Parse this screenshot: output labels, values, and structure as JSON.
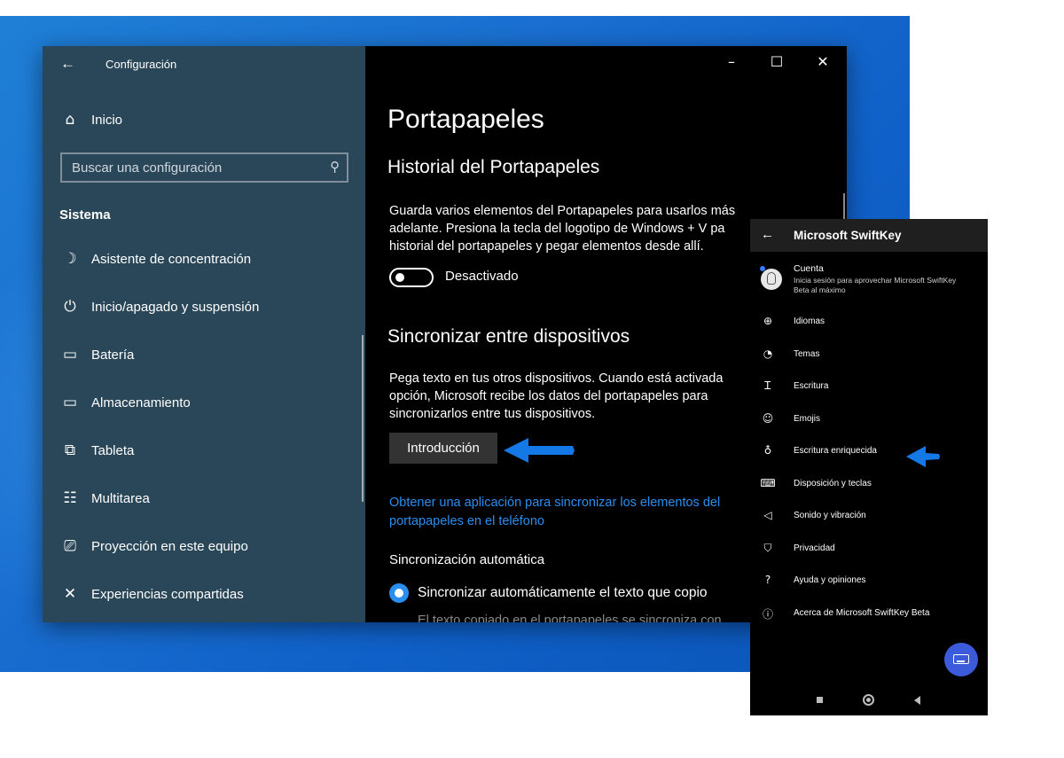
{
  "settings": {
    "window_title": "Configuración",
    "home_label": "Inicio",
    "search_placeholder": "Buscar una configuración",
    "section": "Sistema",
    "nav_items": [
      {
        "label": "Asistente de concentración",
        "icon": "moon-icon"
      },
      {
        "label": "Inicio/apagado y suspensión",
        "icon": "power-icon"
      },
      {
        "label": "Batería",
        "icon": "battery-icon"
      },
      {
        "label": "Almacenamiento",
        "icon": "storage-icon"
      },
      {
        "label": "Tableta",
        "icon": "tablet-icon"
      },
      {
        "label": "Multitarea",
        "icon": "multitask-icon"
      },
      {
        "label": "Proyección en este equipo",
        "icon": "projection-icon"
      },
      {
        "label": "Experiencias compartidas",
        "icon": "shared-experiences-icon"
      }
    ]
  },
  "content": {
    "page_title": "Portapapeles",
    "history_heading": "Historial del Portapapeles",
    "history_text_1": "Guarda varios elementos del Portapapeles para usarlos más",
    "history_text_2": "adelante. Presiona la tecla del logotipo de Windows + V pa",
    "history_text_3": "historial del portapapeles y pegar elementos desde allí.",
    "toggle_label": "Desactivado",
    "toggle_state": "off",
    "sync_heading": "Sincronizar entre dispositivos",
    "sync_text_1": "Pega texto en tus otros dispositivos. Cuando está activada",
    "sync_text_2": "opción, Microsoft recibe los datos del portapapeles para",
    "sync_text_3": "sincronizarlos entre tus dispositivos.",
    "intro_button": "Introducción",
    "link_1": "Obtener una aplicación para sincronizar los elementos del",
    "link_2": "portapapeles en el teléfono",
    "auto_sync_heading": "Sincronización automática",
    "radio_label": "Sincronizar automáticamente el texto que copio",
    "cut_text": "El texto copiado en el portapapeles se sincroniza con"
  },
  "phone": {
    "title": "Microsoft SwiftKey",
    "account_title": "Cuenta",
    "account_sub": "Inicia sesión para aprovechar Microsoft SwiftKey Beta al máximo",
    "items": [
      {
        "label": "Idiomas",
        "icon": "globe-icon"
      },
      {
        "label": "Temas",
        "icon": "palette-icon"
      },
      {
        "label": "Escritura",
        "icon": "text-cursor-icon"
      },
      {
        "label": "Emojis",
        "icon": "emoji-icon"
      },
      {
        "label": "Escritura enriquecida",
        "icon": "microphone-icon"
      },
      {
        "label": "Disposición y teclas",
        "icon": "keyboard-icon"
      },
      {
        "label": "Sonido y vibración",
        "icon": "speaker-icon"
      },
      {
        "label": "Privacidad",
        "icon": "shield-icon"
      },
      {
        "label": "Ayuda y opiniones",
        "icon": "help-icon"
      },
      {
        "label": "Acerca de Microsoft SwiftKey Beta",
        "icon": "info-icon"
      }
    ]
  },
  "colors": {
    "sidebar_bg": "#2a4759",
    "accent": "#2a8ef0",
    "arrow": "#1479e6",
    "fab": "#3b5bdb"
  }
}
